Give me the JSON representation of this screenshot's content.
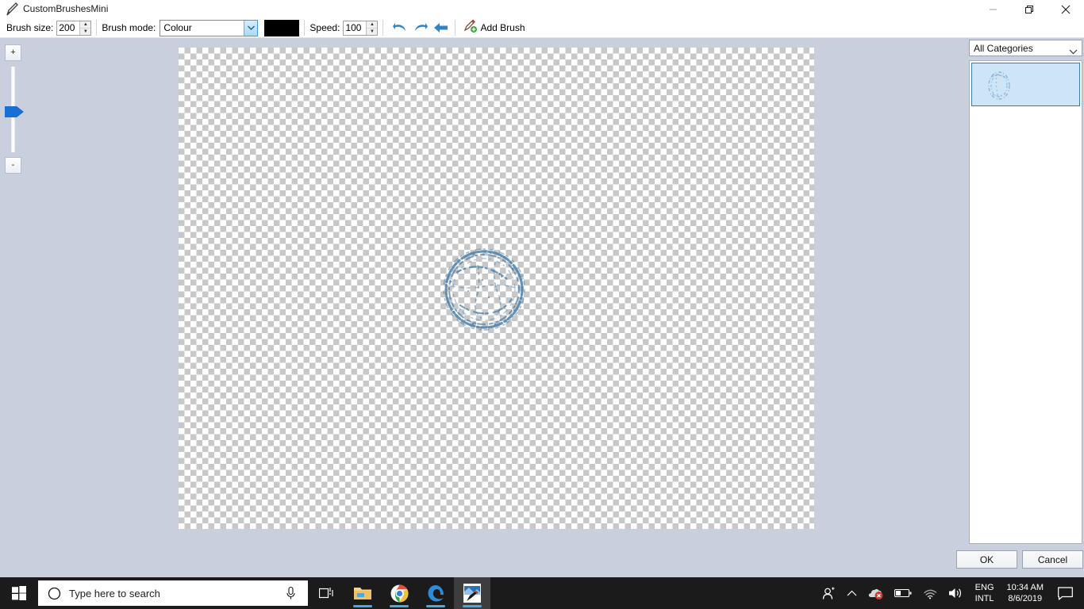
{
  "window": {
    "title": "CustomBrushesMini",
    "title_icon": "paintbrush-icon",
    "minimize_icon": "minimize-icon",
    "maximize_icon": "maximize-icon",
    "close_icon": "close-icon"
  },
  "toolbar": {
    "brush_size_label": "Brush size:",
    "brush_size_value": "200",
    "brush_mode_label": "Brush mode:",
    "brush_mode_value": "Colour",
    "brush_mode_options": [
      "Colour"
    ],
    "color_swatch_hex": "#000000",
    "speed_label": "Speed:",
    "speed_value": "100",
    "undo_icon": "undo-arrow-icon",
    "redo_icon": "redo-arrow-icon",
    "back_icon": "back-arrow-icon",
    "add_brush_icon": "add-brush-icon",
    "add_brush_label": "Add Brush",
    "spin_up": "▲",
    "spin_down": "▼"
  },
  "left_panel": {
    "zoom_in_label": "+",
    "zoom_out_label": "-",
    "slider_name": "zoom-slider"
  },
  "canvas": {
    "name": "drawing-canvas",
    "transparent_checker": true,
    "stroke_name": "water-splash-circle-stroke",
    "stroke_color": "#4a7fa8"
  },
  "right_panel": {
    "category_value": "All Categories",
    "category_options": [
      "All Categories"
    ],
    "chevron_icon": "chevron-down-icon",
    "brushes": [
      {
        "name": "water-splash-brush",
        "selected": true
      }
    ]
  },
  "dialog": {
    "ok_label": "OK",
    "cancel_label": "Cancel"
  },
  "taskbar": {
    "start_icon": "windows-start-icon",
    "search_icon": "search-circle-icon",
    "search_placeholder": "Type here to search",
    "mic_icon": "microphone-icon",
    "task_view_icon": "task-view-icon",
    "apps": [
      {
        "name": "file-explorer-icon",
        "active": false,
        "running": true
      },
      {
        "name": "google-chrome-icon",
        "active": false,
        "running": true
      },
      {
        "name": "microsoft-edge-icon",
        "active": false,
        "running": true
      },
      {
        "name": "custom-brushes-app-icon",
        "active": true,
        "running": true
      }
    ],
    "tray": {
      "people_icon": "people-icon",
      "show_hidden_icon": "chevron-up-icon",
      "onedrive_icon": "onedrive-error-icon",
      "battery_icon": "battery-icon",
      "network_icon": "wifi-icon",
      "volume_icon": "speaker-icon",
      "language_line1": "ENG",
      "language_line2": "INTL",
      "time": "10:34 AM",
      "date": "8/6/2019",
      "action_center_icon": "action-center-icon"
    }
  }
}
